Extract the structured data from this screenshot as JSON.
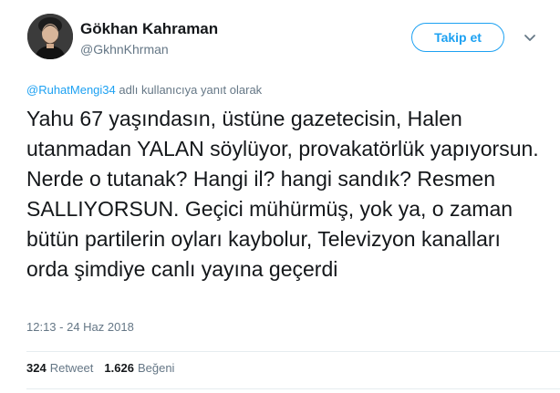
{
  "author": {
    "name": "Gökhan Kahraman",
    "handle": "@GkhnKhrman",
    "avatar_icon": "person-avatar"
  },
  "follow_button": {
    "label": "Takip et"
  },
  "menu_icon": "chevron-down-icon",
  "reply": {
    "mention": "@RuhatMengi34",
    "suffix": " adlı kullanıcıya yanıt olarak"
  },
  "tweet_text": "Yahu 67 yaşındasın, üstüne gazetecisin, Halen utanmadan YALAN söylüyor, provakatörlük yapıyorsun. Nerde o tutanak? Hangi il? hangi sandık? Resmen SALLIYORSUN. Geçici mühürmüş, yok ya, o zaman bütün partilerin oyları kaybolur, Televizyon kanalları orda şimdiye canlı yayına geçerdi",
  "timestamp": "12:13 - 24 Haz 2018",
  "stats": {
    "retweets": {
      "count": "324",
      "label": "Retweet"
    },
    "likes": {
      "count": "1.626",
      "label": "Beğeni"
    }
  },
  "colors": {
    "accent": "#1da1f2",
    "secondary_text": "#657786",
    "primary_text": "#14171a",
    "divider": "#e6ecf0"
  }
}
